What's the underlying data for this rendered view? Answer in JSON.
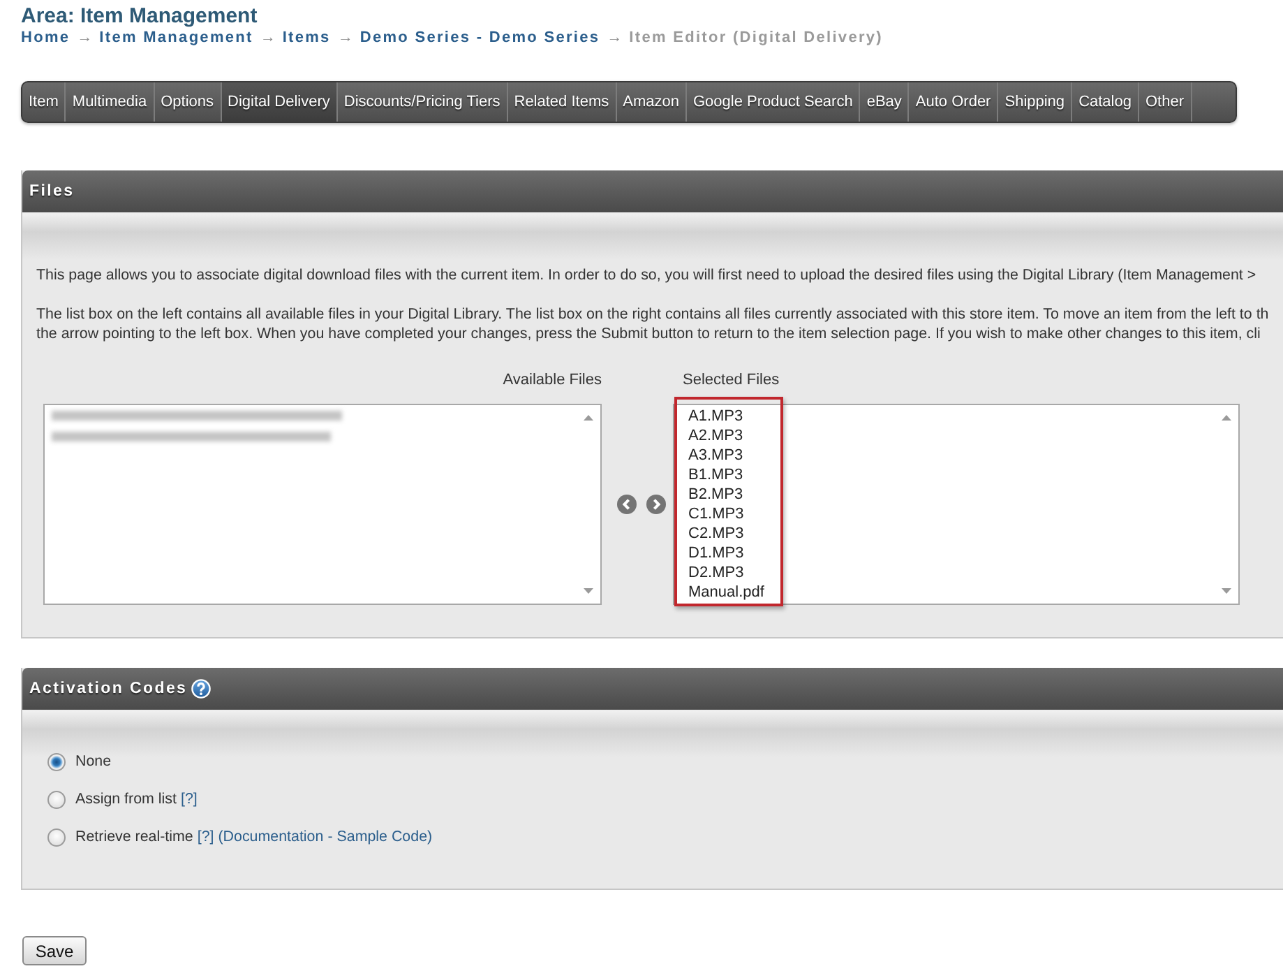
{
  "page": {
    "area_title": "Area: Item Management"
  },
  "breadcrumb": [
    {
      "label": "Home",
      "current": false,
      "arrow": "→"
    },
    {
      "label": "Item Management",
      "current": false,
      "arrow": "→"
    },
    {
      "label": "Items",
      "current": false,
      "arrow": "→"
    },
    {
      "label": "Demo Series - Demo Series",
      "current": false,
      "arrow": "→"
    },
    {
      "label": "Item Editor (Digital Delivery)",
      "current": true
    }
  ],
  "tabs": [
    {
      "label": "Item",
      "selected": false
    },
    {
      "label": "Multimedia",
      "selected": false
    },
    {
      "label": "Options",
      "selected": false
    },
    {
      "label": "Digital Delivery",
      "selected": true
    },
    {
      "label": "Discounts/Pricing Tiers",
      "selected": false
    },
    {
      "label": "Related Items",
      "selected": false
    },
    {
      "label": "Amazon",
      "selected": false
    },
    {
      "label": "Google Product Search",
      "selected": false
    },
    {
      "label": "eBay",
      "selected": false
    },
    {
      "label": "Auto Order",
      "selected": false
    },
    {
      "label": "Shipping",
      "selected": false
    },
    {
      "label": "Catalog",
      "selected": false
    },
    {
      "label": "Other",
      "selected": false
    }
  ],
  "files_panel": {
    "title": "Files",
    "paragraphs": [
      "This page allows you to associate digital download files with the current item. In order to do so, you will first need to upload the desired files using the Digital Library (Item Management >",
      "The list box on the left contains all available files in your Digital Library. The list box on the right contains all files currently associated with this store item. To move an item from the left to th\nthe arrow pointing to the left box. When you have completed your changes, press the Submit button to return to the item selection page. If you wish to make other changes to this item, cli"
    ],
    "available_label": "Available Files",
    "selected_label": "Selected Files",
    "available_files": [
      {
        "redacted": true
      },
      {
        "redacted": true
      }
    ],
    "selected_files": [
      "A1.MP3",
      "A2.MP3",
      "A3.MP3",
      "B1.MP3",
      "B2.MP3",
      "C1.MP3",
      "C2.MP3",
      "D1.MP3",
      "D2.MP3",
      "Manual.pdf"
    ],
    "selected_files_highlighted": true
  },
  "activation_panel": {
    "title": "Activation Codes",
    "options": [
      {
        "label": "None",
        "selected": true
      },
      {
        "label": "Assign from list",
        "selected": false,
        "help_link": "[?]"
      },
      {
        "label": "Retrieve real-time",
        "selected": false,
        "help_link": "[?]",
        "extra_links": [
          "(Documentation",
          "Sample Code)"
        ],
        "extra_separator": "-"
      }
    ]
  },
  "save_button": {
    "label": "Save"
  }
}
